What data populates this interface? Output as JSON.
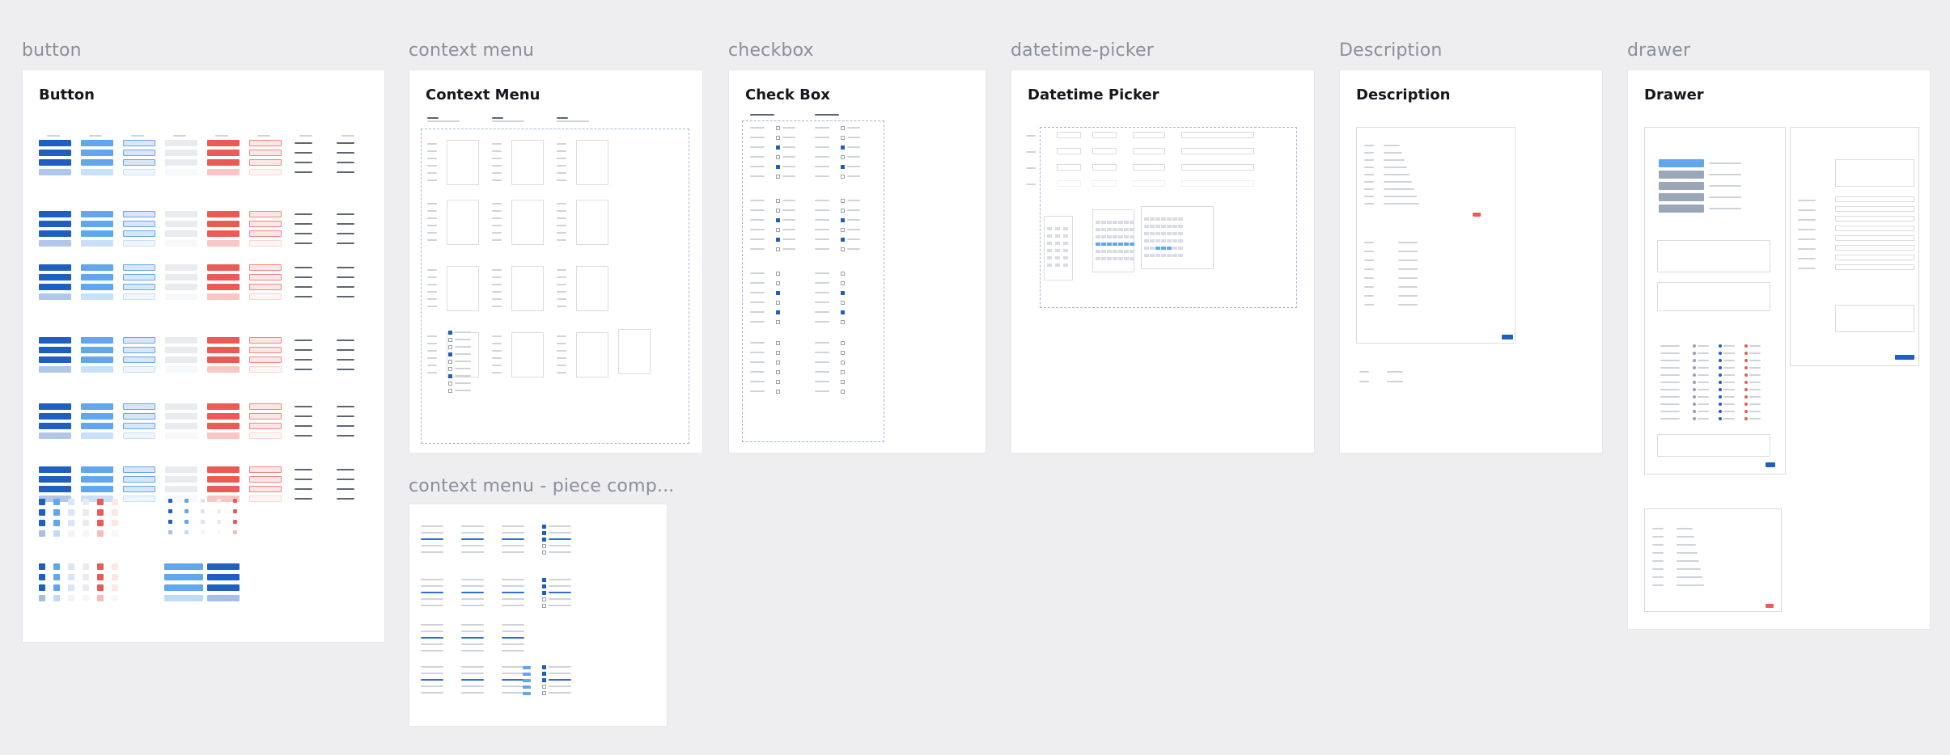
{
  "frames": {
    "button": {
      "label": "button",
      "title": "Button"
    },
    "context_menu": {
      "label": "context menu",
      "title": "Context Menu"
    },
    "checkbox": {
      "label": "checkbox",
      "title": "Check Box"
    },
    "datetime_picker": {
      "label": "datetime-picker",
      "title": "Datetime  Picker"
    },
    "description": {
      "label": "Description",
      "title": "Description"
    },
    "drawer": {
      "label": "drawer",
      "title": "Drawer"
    },
    "context_piece": {
      "label": "context menu - piece comp..."
    }
  },
  "colors": {
    "canvas": "#eeeef0",
    "primary": "#1f5fbf",
    "secondary": "#62a6ee",
    "danger": "#ea5b55",
    "frame_bg": "#ffffff"
  }
}
